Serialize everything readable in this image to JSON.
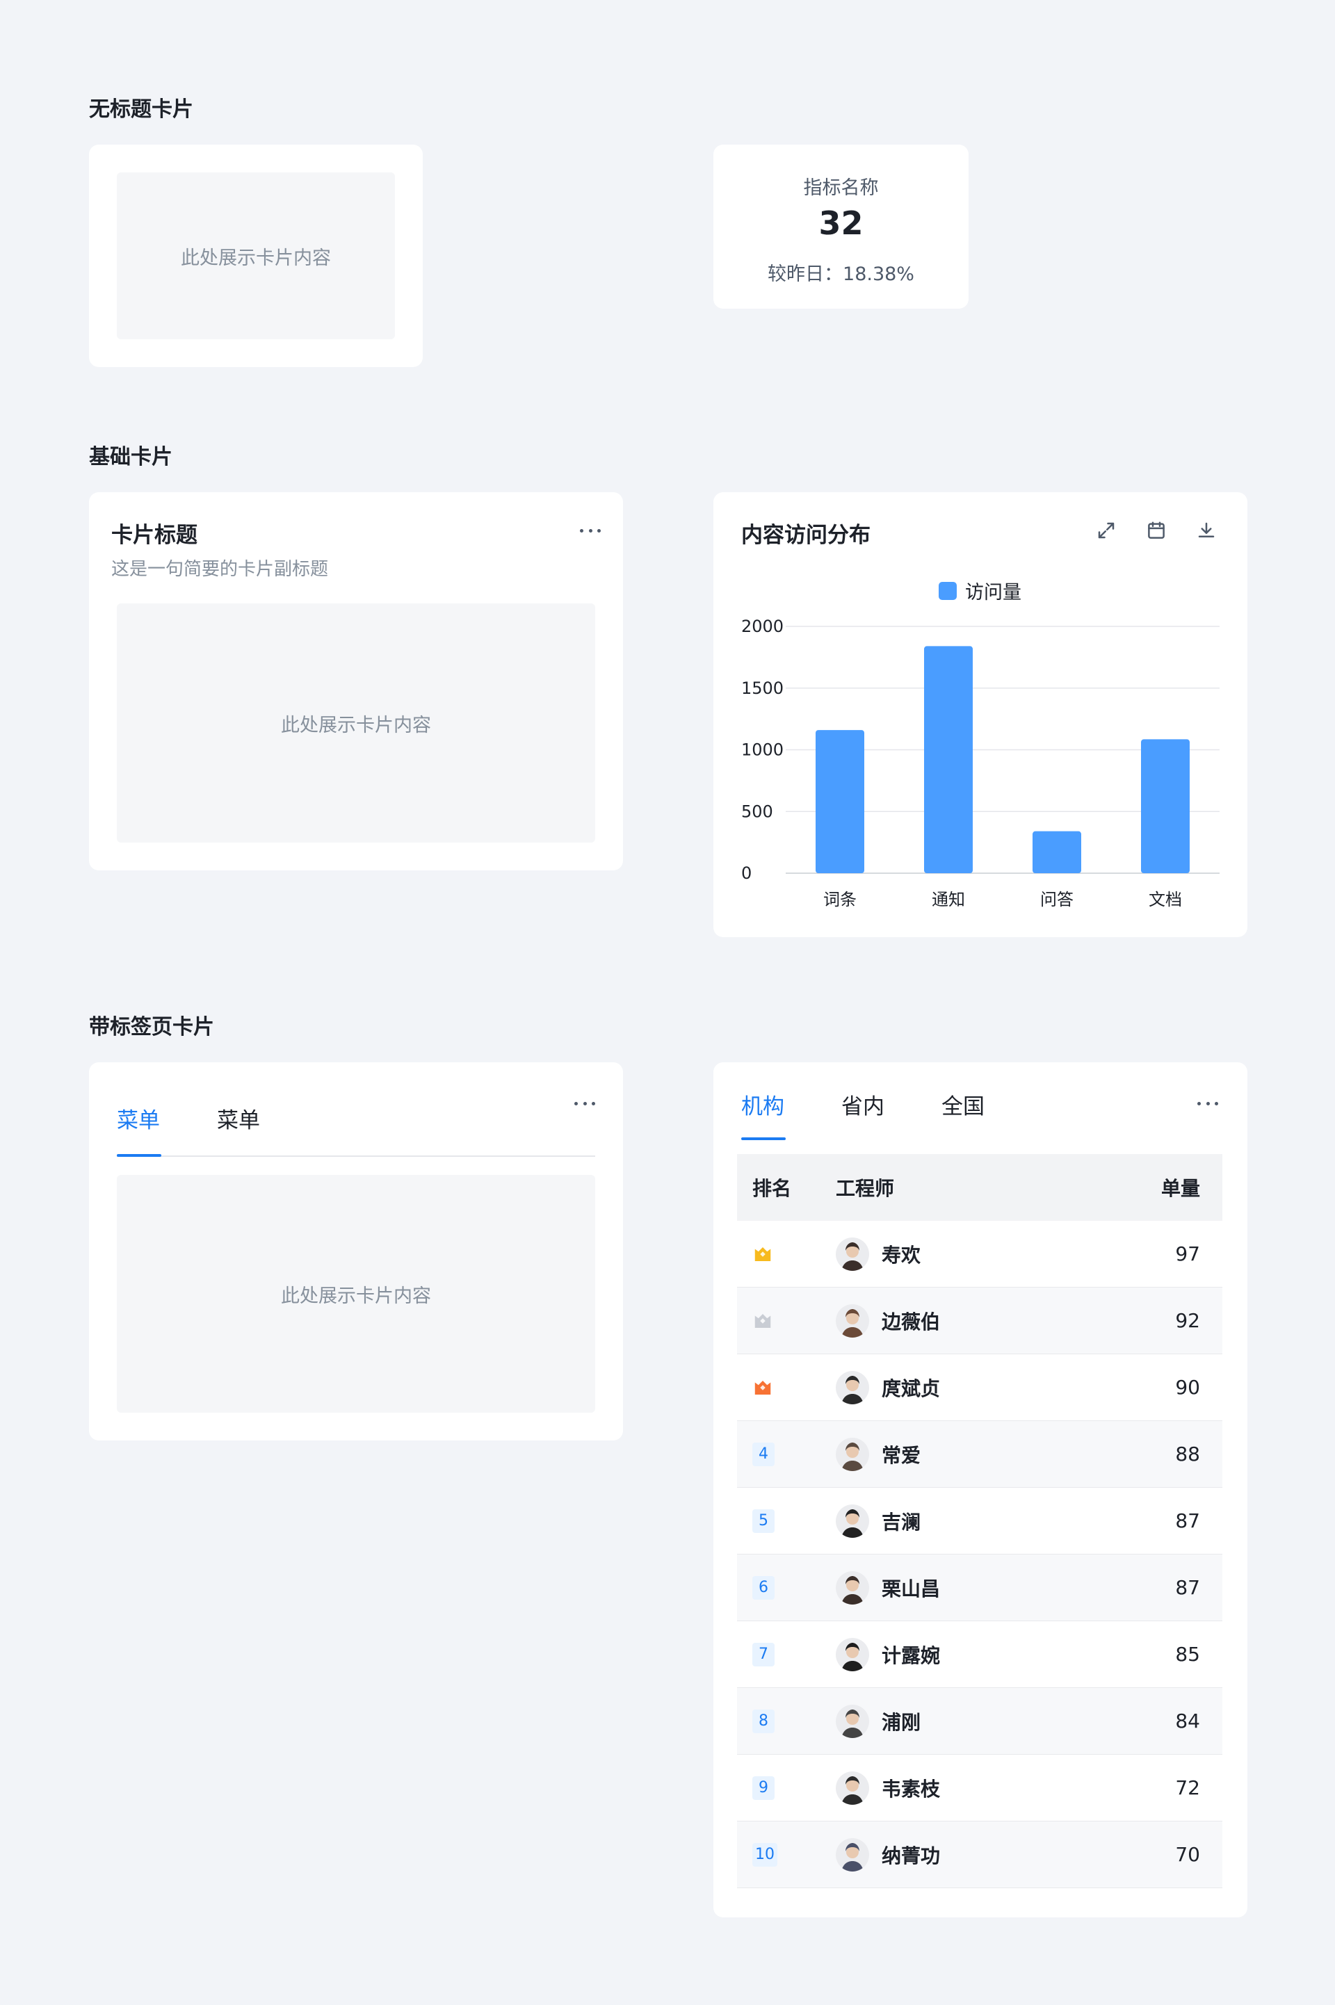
{
  "sections": {
    "untitled": "无标题卡片",
    "basic": "基础卡片",
    "tabbed": "带标签页卡片"
  },
  "placeholder_text": "此处展示卡片内容",
  "metric_card": {
    "name": "指标名称",
    "value": "32",
    "compare": "较昨日：18.38%"
  },
  "basic_card": {
    "title": "卡片标题",
    "subtitle": "这是一句简要的卡片副标题"
  },
  "chart_card": {
    "title": "内容访问分布",
    "icons": [
      "expand-icon",
      "calendar-icon",
      "download-icon"
    ]
  },
  "chart_data": {
    "type": "bar",
    "categories": [
      "词条",
      "通知",
      "问答",
      "文档"
    ],
    "series": [
      {
        "name": "访问量",
        "values": [
          1160,
          1840,
          340,
          1085
        ],
        "color": "#4a9dff"
      }
    ],
    "ylim": [
      0,
      2000
    ],
    "yticks": [
      "0",
      "500",
      "1000",
      "1500",
      "2000"
    ],
    "grid": true,
    "legend": "top-center"
  },
  "tab_card_left": {
    "tabs": [
      "菜单",
      "菜单"
    ],
    "active": 0
  },
  "tab_card_right": {
    "tabs": [
      "机构",
      "省内",
      "全国"
    ],
    "active": 0,
    "columns": [
      "排名",
      "工程师",
      "单量"
    ],
    "rows": [
      {
        "rank": "1",
        "name": "寿欢",
        "qty": "97",
        "medal": "gold"
      },
      {
        "rank": "2",
        "name": "边薇伯",
        "qty": "92",
        "medal": "silver"
      },
      {
        "rank": "3",
        "name": "庹斌贞",
        "qty": "90",
        "medal": "bronze"
      },
      {
        "rank": "4",
        "name": "常爱",
        "qty": "88"
      },
      {
        "rank": "5",
        "name": "吉澜",
        "qty": "87"
      },
      {
        "rank": "6",
        "name": "栗山昌",
        "qty": "87"
      },
      {
        "rank": "7",
        "name": "计露婉",
        "qty": "85"
      },
      {
        "rank": "8",
        "name": "浦刚",
        "qty": "84"
      },
      {
        "rank": "9",
        "name": "韦素枝",
        "qty": "72"
      },
      {
        "rank": "10",
        "name": "纳菁功",
        "qty": "70"
      }
    ],
    "colors": {
      "medal_gold": "#f7ba1e",
      "medal_silver": "#c9cdd4",
      "medal_bronze": "#f77234",
      "accent": "#1b7bf2"
    }
  }
}
